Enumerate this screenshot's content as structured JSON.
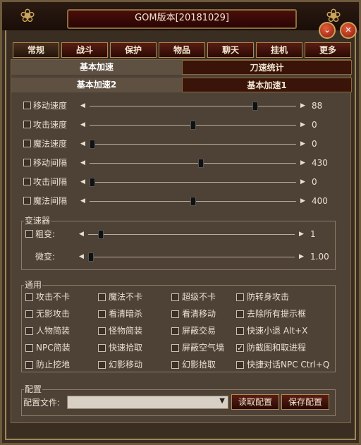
{
  "window": {
    "title": "GOM版本[20181029]"
  },
  "tabs": [
    "常规",
    "战斗",
    "保护",
    "物品",
    "聊天",
    "挂机",
    "更多"
  ],
  "subtabs": {
    "top_left": "基本加速",
    "top_right": "刀速统计",
    "bottom_left": "基本加速2",
    "bottom_right": "基本加速1"
  },
  "sliders": [
    {
      "label": "移动速度",
      "value": "88",
      "level": 0.81
    },
    {
      "label": "攻击速度",
      "value": "0",
      "level": 0.5
    },
    {
      "label": "魔法速度",
      "value": "0",
      "level": 0.0
    },
    {
      "label": "移动间隔",
      "value": "430",
      "level": 0.54
    },
    {
      "label": "攻击间隔",
      "value": "0",
      "level": 0.0
    },
    {
      "label": "魔法间隔",
      "value": "400",
      "level": 0.5
    }
  ],
  "speed_group": {
    "title": "变速器",
    "coarse": {
      "label": "粗变:",
      "value": "1",
      "level": 0.05
    },
    "fine": {
      "label": "微变:",
      "value": "1.00",
      "level": 0.0
    }
  },
  "general_group": {
    "title": "通用",
    "options": [
      {
        "label": "攻击不卡",
        "checked": false
      },
      {
        "label": "魔法不卡",
        "checked": false
      },
      {
        "label": "超级不卡",
        "checked": false
      },
      {
        "label": "防转身攻击",
        "checked": false
      },
      {
        "label": "无影攻击",
        "checked": false
      },
      {
        "label": "看清暗杀",
        "checked": false
      },
      {
        "label": "看清移动",
        "checked": false
      },
      {
        "label": "去除所有提示框",
        "checked": false
      },
      {
        "label": "人物简装",
        "checked": false
      },
      {
        "label": "怪物简装",
        "checked": false
      },
      {
        "label": "屏蔽交易",
        "checked": false
      },
      {
        "label": "快速小退 Alt+X",
        "checked": false
      },
      {
        "label": "NPC简装",
        "checked": false
      },
      {
        "label": "快速拾取",
        "checked": false
      },
      {
        "label": "屏蔽空气墙",
        "checked": false
      },
      {
        "label": "防截图和取进程",
        "checked": true
      },
      {
        "label": "防止挖地",
        "checked": false
      },
      {
        "label": "幻影移动",
        "checked": false
      },
      {
        "label": "幻影拾取",
        "checked": false
      },
      {
        "label": "快捷对话NPC Ctrl+Q",
        "checked": false
      }
    ]
  },
  "config_group": {
    "title": "配置",
    "file_label": "配置文件:",
    "file_value": "",
    "load_button": "读取配置",
    "save_button": "保存配置"
  },
  "colors": {
    "accent": "#5a1e12",
    "gold": "#b08a52",
    "panel": "#4e4136"
  },
  "icons": {
    "minimize": "chevron-down-icon",
    "close": "close-icon",
    "ornament": "dragon-icon"
  }
}
